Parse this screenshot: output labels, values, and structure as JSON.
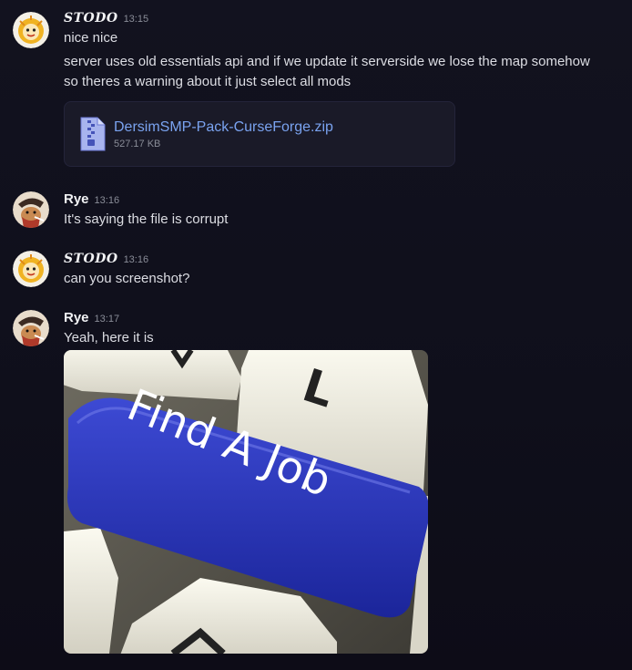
{
  "messages": [
    {
      "username": "STODO",
      "timestamp": "13:15",
      "lines": [
        "nice nice",
        "server uses old essentials api and if we update it serverside we lose the map somehow",
        "so theres a warning about it just select all mods"
      ],
      "attachment": {
        "file_name": "DersimSMP-Pack-CurseForge.zip",
        "file_size": "527.17 KB",
        "icon": "zip-file-icon"
      }
    },
    {
      "username": "Rye",
      "timestamp": "13:16",
      "lines": [
        "It's saying the file is corrupt"
      ]
    },
    {
      "username": "STODO",
      "timestamp": "13:16",
      "lines": [
        "can you screenshot?"
      ]
    },
    {
      "username": "Rye",
      "timestamp": "13:17",
      "lines": [
        "Yeah, here it is"
      ],
      "image": {
        "key_text": "Find A Job",
        "other_keys": [
          "L"
        ]
      }
    }
  ],
  "colors": {
    "background": "#12121f",
    "link": "#7aa3f0",
    "key_blue": "#2a37b6"
  }
}
